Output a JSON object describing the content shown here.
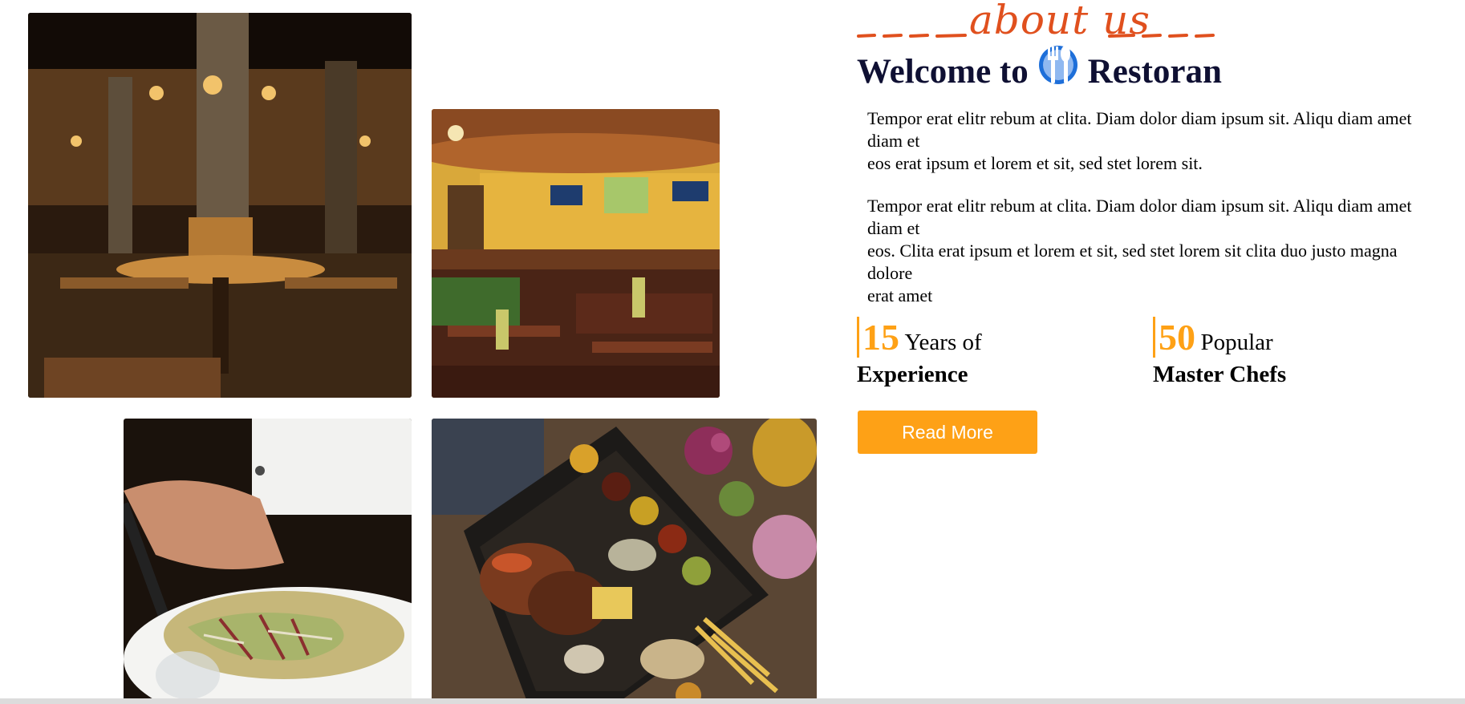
{
  "images": {
    "interior_dark": "restaurant-interior-dark",
    "interior_yellow": "restaurant-interior-yellow",
    "salad": "salad-plate",
    "platter": "grilled-platter"
  },
  "about": {
    "heading": "about us"
  },
  "welcome": {
    "before": "Welcome to",
    "icon": "utensils-icon",
    "brand": "Restoran"
  },
  "paragraphs": [
    [
      "Tempor erat elitr rebum at clita. Diam dolor diam ipsum sit. Aliqu diam amet diam et",
      "eos erat ipsum et lorem et sit, sed stet lorem sit."
    ],
    [
      "Tempor erat elitr rebum at clita. Diam dolor diam ipsum sit. Aliqu diam amet diam et",
      "eos. Clita erat ipsum et lorem et sit, sed stet lorem sit clita duo justo magna dolore",
      "erat amet"
    ]
  ],
  "stats": [
    {
      "number": "15",
      "suffix": "Years of",
      "line2": "Experience"
    },
    {
      "number": "50",
      "suffix": "Popular",
      "line2": "Master Chefs"
    }
  ],
  "button": {
    "label": "Read More"
  },
  "colors": {
    "accent": "#fea116",
    "heading_script": "#e0501e",
    "title": "#0f1033",
    "icon_blue": "#1e6fd9"
  }
}
